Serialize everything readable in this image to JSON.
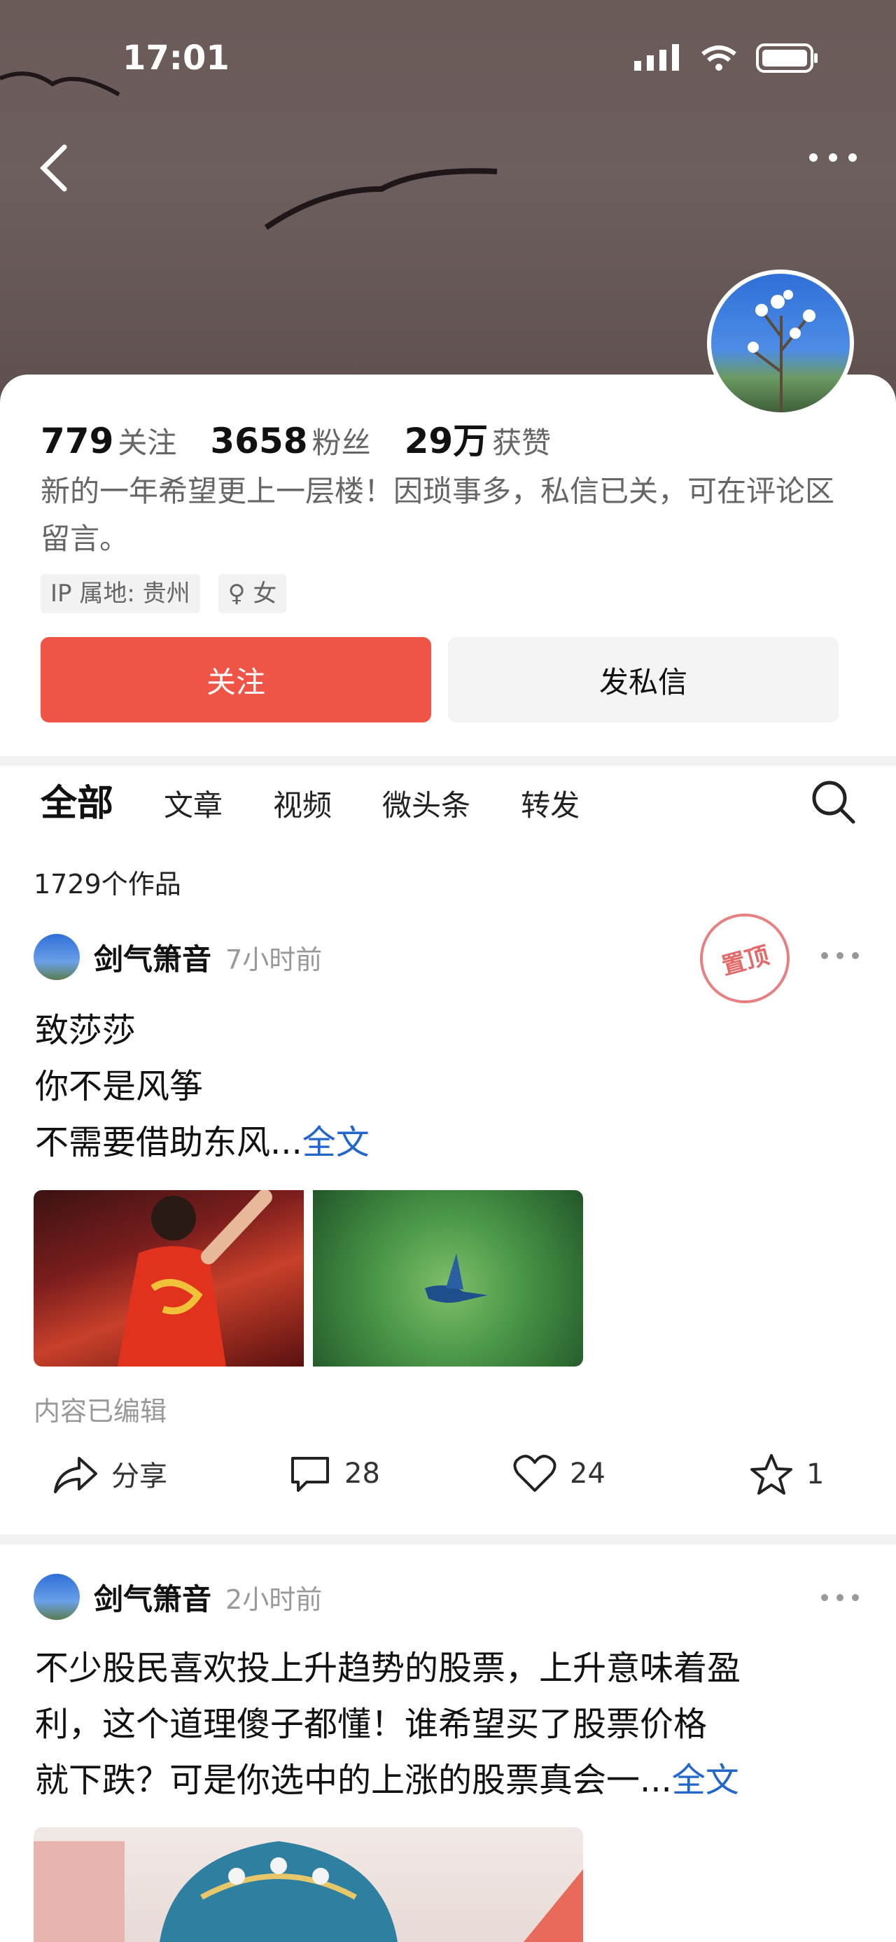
{
  "status_bar": {
    "time": "17:01"
  },
  "profile": {
    "stats": [
      {
        "value": "779",
        "label": "关注"
      },
      {
        "value": "3658",
        "label": "粉丝"
      },
      {
        "value": "29万",
        "label": "获赞"
      }
    ],
    "bio": "新的一年希望更上一层楼！因琐事多，私信已关，可在评论区留言。",
    "tags": [
      "IP 属地: 贵州",
      "♀ 女"
    ],
    "follow_label": "关注",
    "message_label": "发私信"
  },
  "tabs": [
    "全部",
    "文章",
    "视频",
    "微头条",
    "转发"
  ],
  "works_count": "1729个作品",
  "posts": [
    {
      "author": "剑气箫音",
      "time": "7小时前",
      "pinned_label": "置顶",
      "lines": [
        "致莎莎",
        "你不是风筝",
        "不需要借助东风..."
      ],
      "more_label": "全文",
      "edited_note": "内容已编辑",
      "actions": {
        "share": "分享",
        "comments": "28",
        "likes": "24",
        "favorites": "1"
      }
    },
    {
      "author": "剑气箫音",
      "time": "2小时前",
      "lines": [
        "不少股民喜欢投上升趋势的股票，上升意味着盈",
        "利，这个道理傻子都懂！谁希望买了股票价格",
        "就下跌？可是你选中的上涨的股票真会一..."
      ],
      "more_label": "全文"
    }
  ],
  "colors": {
    "accent_red": "#ef5446",
    "link_blue": "#2266cc"
  }
}
